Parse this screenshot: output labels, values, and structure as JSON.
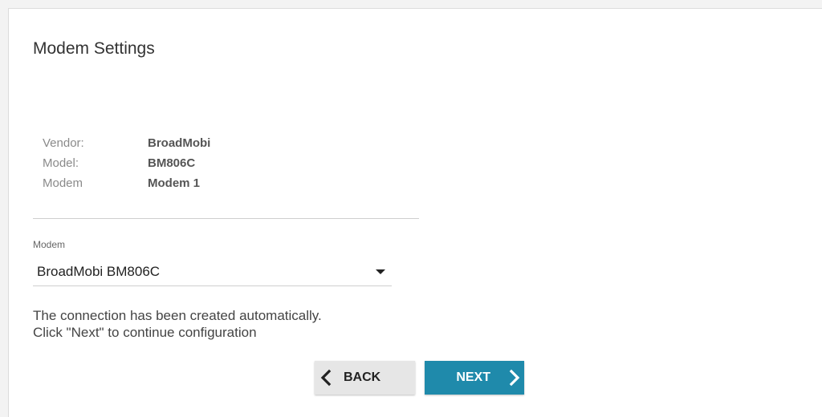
{
  "page": {
    "title": "Modem Settings"
  },
  "info": {
    "rows": [
      {
        "label": "Vendor:",
        "value": "BroadMobi"
      },
      {
        "label": "Model:",
        "value": "BM806C"
      },
      {
        "label": "Modem",
        "value": "Modem 1"
      }
    ]
  },
  "modem_select": {
    "label": "Modem",
    "value": "BroadMobi BM806C",
    "icon": "caret-down-icon"
  },
  "message": {
    "line1": "The connection has been created automatically.",
    "line2": "Click \"Next\" to continue configuration"
  },
  "buttons": {
    "back_label": "BACK",
    "back_icon": "chevron-left-icon",
    "next_label": "NEXT",
    "next_icon": "chevron-right-icon"
  },
  "colors": {
    "next_button": "#1f8aab",
    "back_button": "#e6e6e6"
  }
}
